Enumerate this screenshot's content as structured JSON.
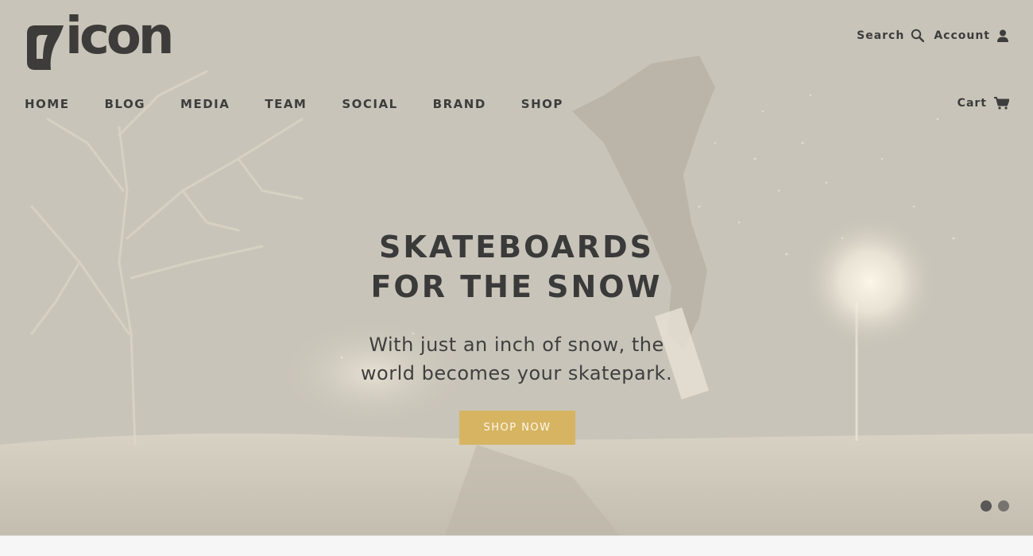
{
  "brand": {
    "logo_text": "icon",
    "logo_mark": "icon-logo-mark"
  },
  "utility_nav": {
    "search_label": "Search",
    "search_icon": "search-icon",
    "account_label": "Account",
    "account_icon": "user-icon"
  },
  "main_nav": {
    "items": [
      {
        "label": "HOME"
      },
      {
        "label": "BLOG"
      },
      {
        "label": "MEDIA"
      },
      {
        "label": "TEAM"
      },
      {
        "label": "SOCIAL"
      },
      {
        "label": "BRAND"
      },
      {
        "label": "SHOP"
      }
    ]
  },
  "cart": {
    "label": "Cart",
    "icon": "cart-icon"
  },
  "hero": {
    "headline_line1": "SKATEBOARDS",
    "headline_line2": "FOR THE SNOW",
    "subtitle_line1": "With just an inch of snow, the",
    "subtitle_line2": "world becomes your skatepark.",
    "cta_label": "SHOP NOW"
  },
  "slider": {
    "slide_count": 2,
    "active_index": 0
  },
  "colors": {
    "hero_background": "#c9c4b9",
    "text_dark": "#3d3d3d",
    "cta_background": "#d6b462",
    "cta_text": "#fff8ea"
  }
}
